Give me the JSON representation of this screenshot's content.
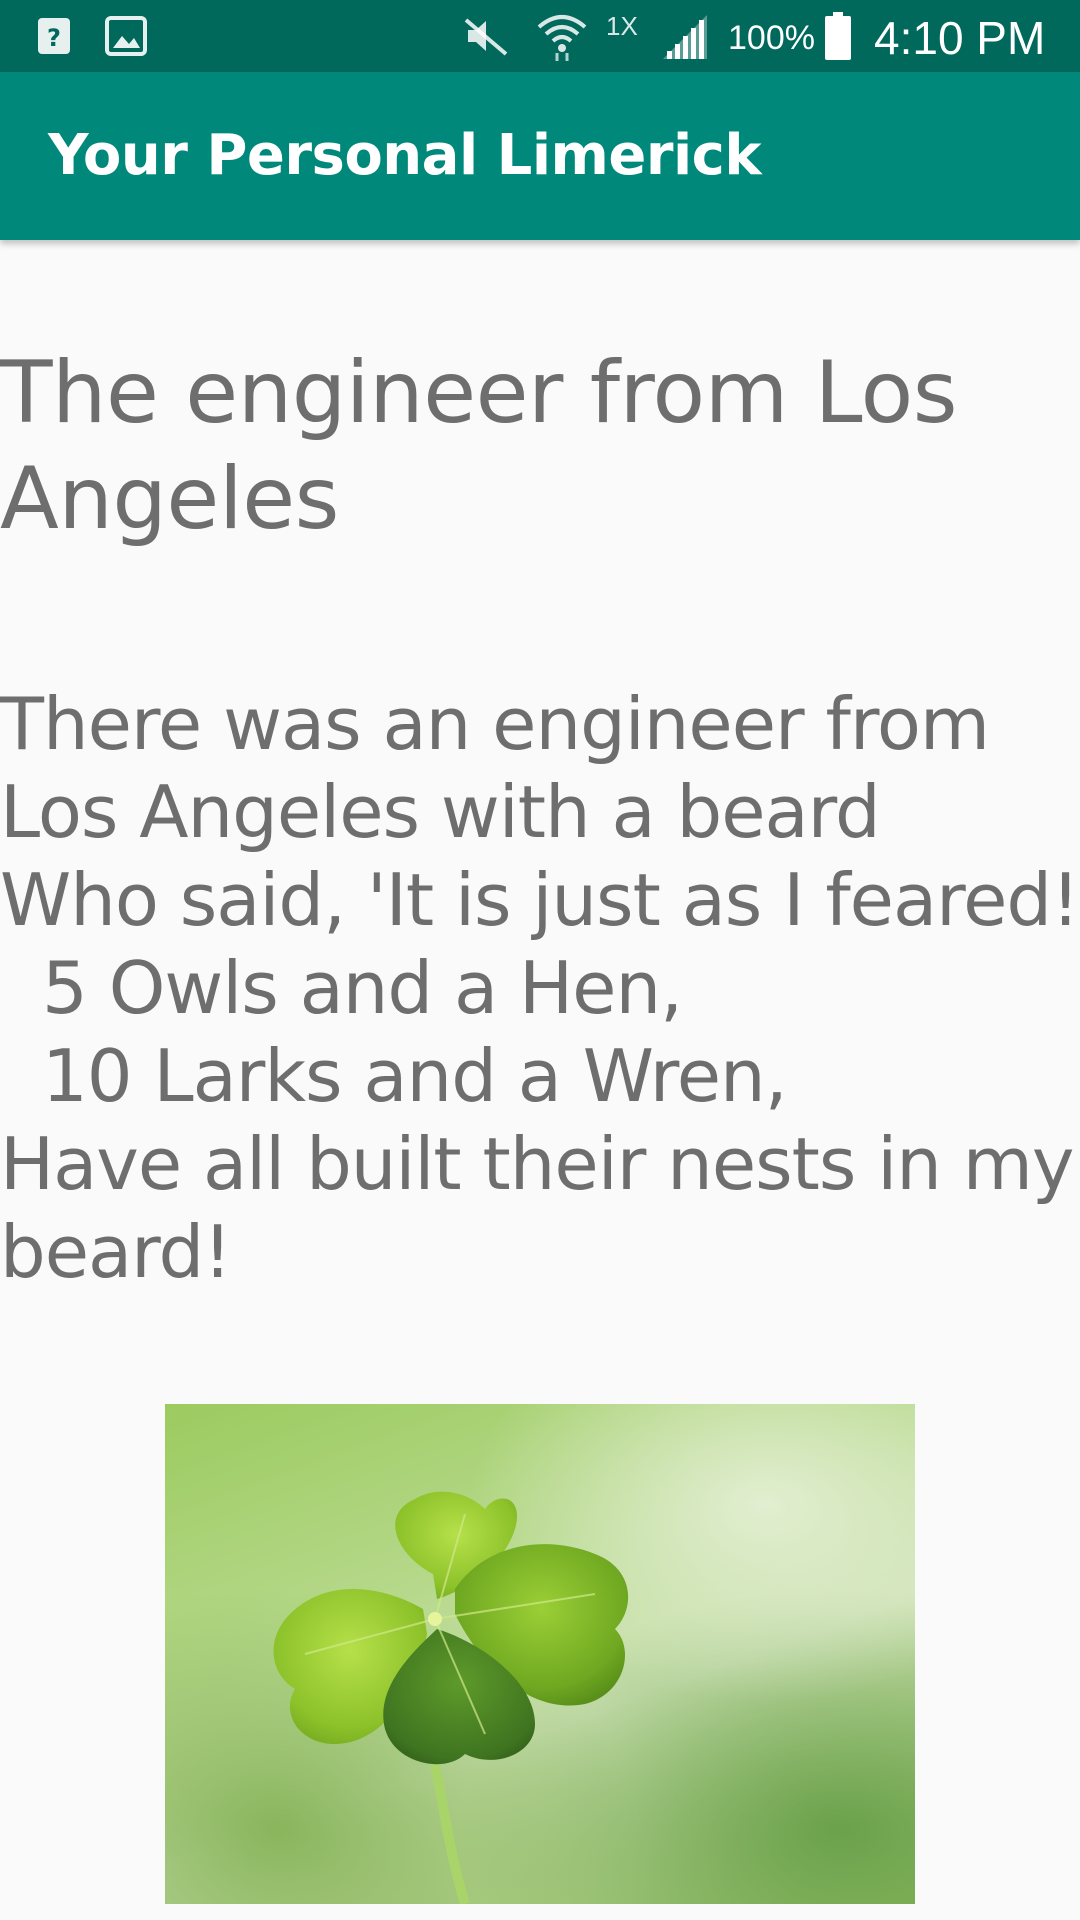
{
  "status_bar": {
    "battery_percent": "100%",
    "time": "4:10 PM",
    "data_indicator": "1X",
    "icons": [
      "help-square-icon",
      "image-icon",
      "mute-icon",
      "wifi-icon",
      "signal-icon",
      "battery-icon"
    ]
  },
  "app_bar": {
    "title": "Your Personal Limerick"
  },
  "limerick": {
    "title": "The engineer from Los Angeles",
    "lines": [
      "There was an engineer from Los Angeles with a beard",
      "Who said, 'It is just as I feared!'",
      "5 Owls and a Hen,",
      "10 Larks and a Wren,",
      "Have all built their nests in my beard!"
    ]
  },
  "image": {
    "subject": "four-leaf-clover"
  },
  "colors": {
    "status_bar": "#00695c",
    "app_bar": "#00897b",
    "text": "#6e6e6e",
    "background": "#fafafa"
  }
}
